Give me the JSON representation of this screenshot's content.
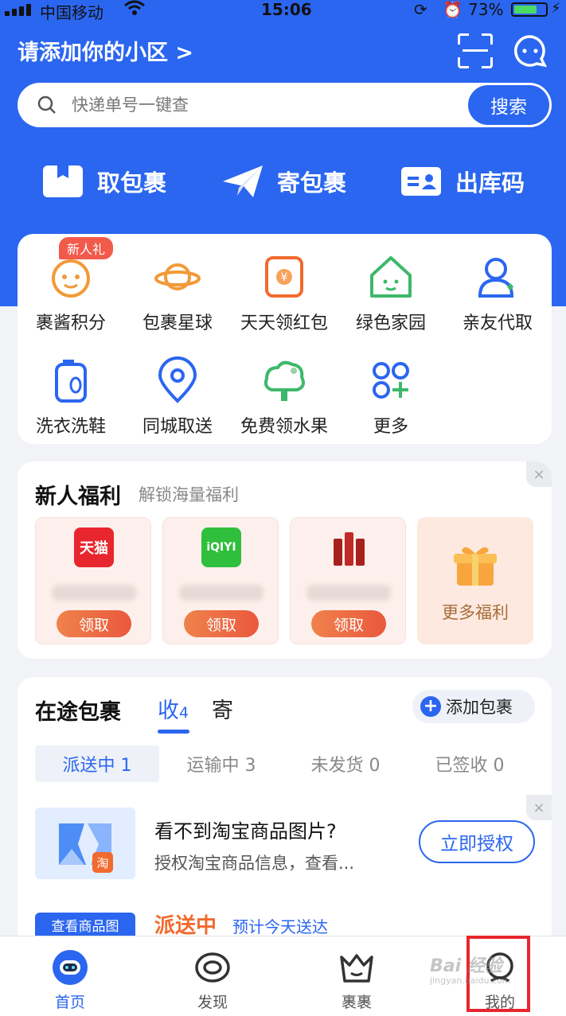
{
  "status_bar": {
    "carrier": "中国移动",
    "time": "15:06",
    "battery": "73%",
    "battery_level": 0.73
  },
  "header": {
    "area_label": "请添加你的小区 >",
    "scan_icon": "scan-icon",
    "chat_icon": "chat-bubble-icon"
  },
  "search": {
    "placeholder": "快递单号一键查",
    "button": "搜索"
  },
  "quick_actions": [
    {
      "label": "取包裹",
      "icon": "package-icon"
    },
    {
      "label": "寄包裹",
      "icon": "paper-plane-icon"
    },
    {
      "label": "出库码",
      "icon": "id-card-icon"
    }
  ],
  "grid": {
    "new_badge": "新人礼",
    "items": [
      {
        "label": "裹酱积分",
        "icon": "mascot-face-icon"
      },
      {
        "label": "包裹星球",
        "icon": "planet-icon"
      },
      {
        "label": "天天领红包",
        "icon": "red-envelope-icon"
      },
      {
        "label": "绿色家园",
        "icon": "green-house-icon"
      },
      {
        "label": "亲友代取",
        "icon": "person-heart-icon"
      },
      {
        "label": "洗衣洗鞋",
        "icon": "laundry-bottle-icon"
      },
      {
        "label": "同城取送",
        "icon": "location-pin-icon"
      },
      {
        "label": "免费领水果",
        "icon": "fruit-tree-icon"
      },
      {
        "label": "更多",
        "icon": "grid-plus-icon"
      }
    ]
  },
  "welfare": {
    "title": "新人福利",
    "subtitle": "解锁海量福利",
    "close": "×",
    "tiles": [
      {
        "logo_text": "天猫",
        "claim": "领取"
      },
      {
        "logo_text": "iQIYI",
        "claim": "领取"
      },
      {
        "logo_text": "",
        "claim": "领取"
      }
    ],
    "more_label": "更多福利"
  },
  "packages": {
    "title": "在途包裹",
    "tab_receive": "收",
    "tab_receive_count": "4",
    "tab_send": "寄",
    "add_button": "添加包裹",
    "status_tabs": [
      {
        "label": "派送中 1",
        "active": true
      },
      {
        "label": "运输中 3",
        "active": false
      },
      {
        "label": "未发货 0",
        "active": false
      },
      {
        "label": "已签收 0",
        "active": false
      }
    ],
    "auth": {
      "title": "看不到淘宝商品图片?",
      "desc": "授权淘宝商品信息，查看...",
      "button": "立即授权",
      "badge": "淘"
    },
    "goods_tag": "查看商品图",
    "dispatch_status": "派送中",
    "eta": "预计今天送达"
  },
  "tabbar": [
    {
      "label": "首页",
      "icon": "home-mascot-icon",
      "active": true
    },
    {
      "label": "发现",
      "icon": "eye-icon",
      "active": false
    },
    {
      "label": "裹裹",
      "icon": "crown-box-icon",
      "active": false
    },
    {
      "label": "我的",
      "icon": "profile-icon",
      "active": false
    }
  ],
  "watermark": "Bai 经验",
  "watermark_sub": "jingyan.baidu.com",
  "colors": {
    "brand_blue": "#2b66f0",
    "orange": "#f26a2e",
    "highlight_box": "#e8262d"
  }
}
